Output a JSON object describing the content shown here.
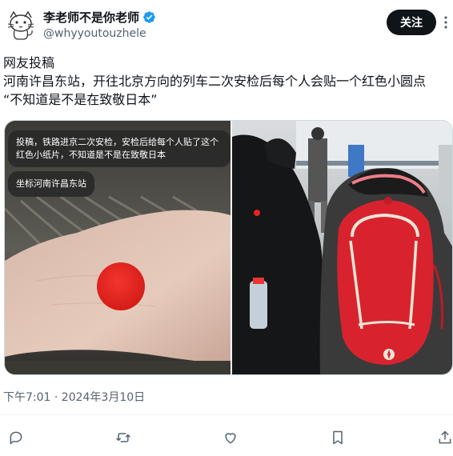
{
  "author": {
    "display_name": "李老师不是你老师",
    "handle": "@whyyoutouzhele",
    "verified": true,
    "avatar_icon": "cat-sketch-avatar"
  },
  "actions": {
    "follow_label": "关注",
    "more_icon": "more-dots-icon"
  },
  "tweet": {
    "lines": [
      "网友投稿",
      "河南许昌东站，开往北京方向的列车二次安检后每个人会贴一个红色小圆点",
      "“不知道是不是在致敬日本”"
    ],
    "timestamp": "下午7:01 · 2024年3月10日"
  },
  "media": {
    "left_bubble_1": "投稿，铁路进京二次安检，安检后给每个人贴了这个红色小纸片，不知道是不是在致敬日本",
    "left_bubble_2": "坐标河南许昌东站"
  },
  "action_bar": [
    "reply-icon",
    "retweet-icon",
    "like-icon",
    "bookmark-icon",
    "share-icon"
  ],
  "colors": {
    "follow_bg": "#0f1419",
    "verified": "#1d9bf0",
    "red_dot": "#e8231f",
    "backpack": "#d8232f",
    "secondary_text": "#536471"
  }
}
